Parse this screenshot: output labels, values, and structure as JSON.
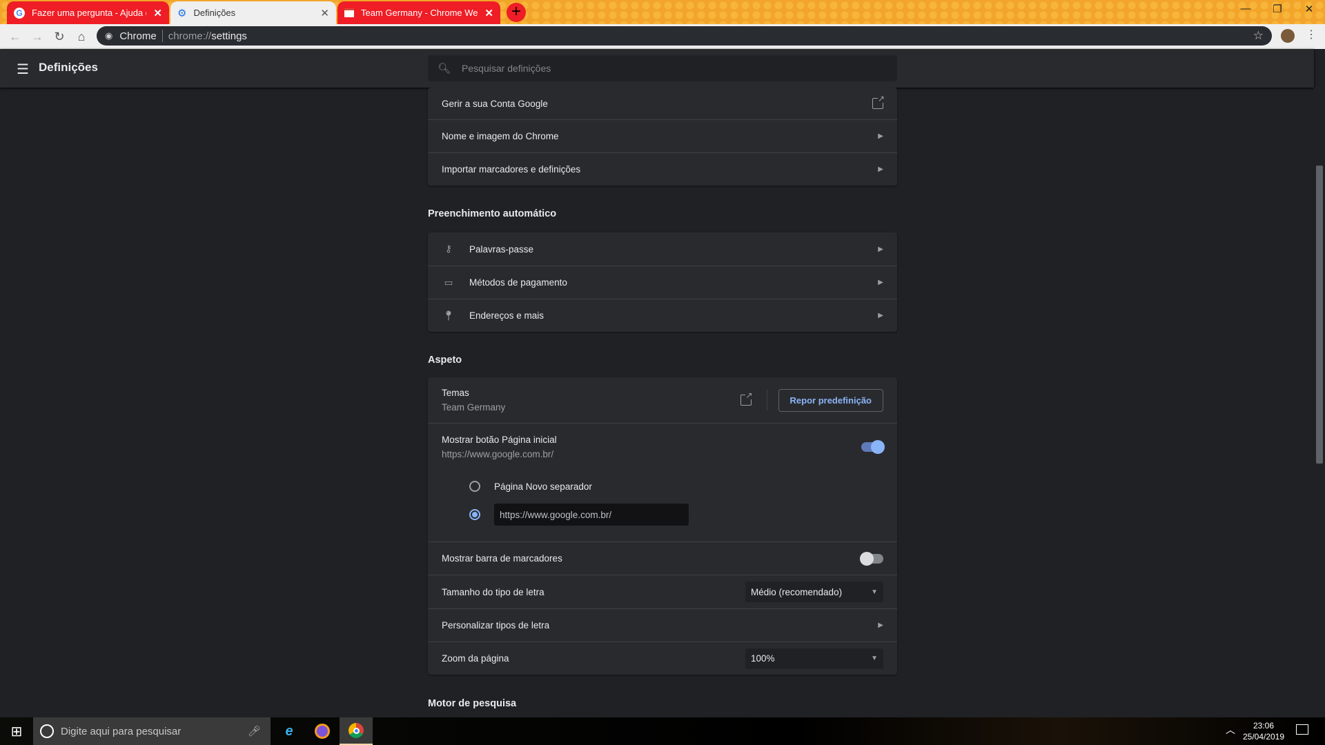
{
  "browser": {
    "tabs": [
      {
        "title": "Fazer uma pergunta - Ajuda do Google Chrome",
        "icon": "google-icon",
        "active": false
      },
      {
        "title": "Definições",
        "icon": "gear-icon",
        "active": true
      },
      {
        "title": "Team Germany - Chrome Web Store",
        "icon": "web-store-icon",
        "active": false
      }
    ],
    "new_tab": "+",
    "omnibox": {
      "site": "Chrome",
      "url_prefix": "chrome://",
      "url_path": "settings"
    }
  },
  "settings": {
    "title": "Definições",
    "search_placeholder": "Pesquisar definições",
    "people_rows": [
      "Gerir a sua Conta Google",
      "Nome e imagem do Chrome",
      "Importar marcadores e definições"
    ],
    "autofill": {
      "heading": "Preenchimento automático",
      "rows": [
        {
          "label": "Palavras-passe",
          "icon": "key-icon"
        },
        {
          "label": "Métodos de pagamento",
          "icon": "credit-card-icon"
        },
        {
          "label": "Endereços e mais",
          "icon": "location-pin-icon"
        }
      ]
    },
    "appearance": {
      "heading": "Aspeto",
      "themes_label": "Temas",
      "themes_value": "Team Germany",
      "reset_button": "Repor predefinição",
      "home_button_label": "Mostrar botão Página inicial",
      "home_button_url": "https://www.google.com.br/",
      "home_button_on": true,
      "radio_new_tab": "Página Novo separador",
      "radio_custom_value": "https://www.google.com.br/",
      "selected_radio": "custom",
      "bookmarks_bar_label": "Mostrar barra de marcadores",
      "bookmarks_bar_on": false,
      "font_size_label": "Tamanho do tipo de letra",
      "font_size_value": "Médio (recomendado)",
      "customize_fonts_label": "Personalizar tipos de letra",
      "zoom_label": "Zoom da página",
      "zoom_value": "100%"
    },
    "search_engine_heading": "Motor de pesquisa"
  },
  "taskbar": {
    "search_placeholder": "Digite aqui para pesquisar",
    "time": "23:06",
    "date": "25/04/2019"
  },
  "colors": {
    "accent": "#8ab4f8",
    "tab_red": "#ef1d25",
    "theme_orange": "#f2a52a",
    "background": "#202124",
    "card": "#292a2d"
  }
}
